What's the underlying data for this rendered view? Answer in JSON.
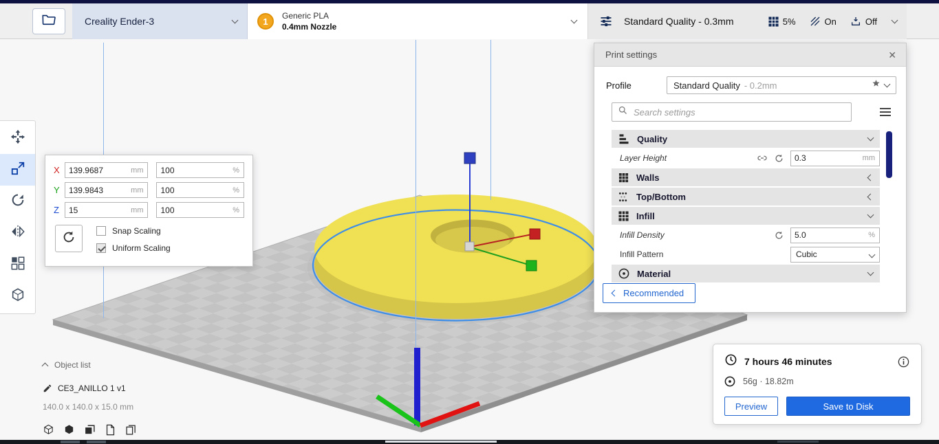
{
  "header": {
    "printer_name": "Creality Ender-3",
    "material_badge": "1",
    "material_name": "Generic PLA",
    "material_nozzle": "0.4mm Nozzle",
    "setup_label": "Standard Quality - 0.3mm",
    "infill_pct": "5%",
    "adhesion_state": "On",
    "support_state": "Off"
  },
  "scale_panel": {
    "rows": [
      {
        "axis": "X",
        "value": "139.9687",
        "unit": "mm",
        "pct": "100",
        "pct_unit": "%"
      },
      {
        "axis": "Y",
        "value": "139.9843",
        "unit": "mm",
        "pct": "100",
        "pct_unit": "%"
      },
      {
        "axis": "Z",
        "value": "15",
        "unit": "mm",
        "pct": "100",
        "pct_unit": "%"
      }
    ],
    "snap_label": "Snap Scaling",
    "uniform_label": "Uniform Scaling"
  },
  "print_settings": {
    "title": "Print settings",
    "close": "✕",
    "profile_label": "Profile",
    "profile_value": "Standard Quality",
    "profile_suffix": "- 0.2mm",
    "search_placeholder": "Search settings",
    "sections": [
      {
        "label": "Quality"
      },
      {
        "label": "Walls"
      },
      {
        "label": "Top/Bottom"
      },
      {
        "label": "Infill"
      },
      {
        "label": "Material"
      }
    ],
    "rows": {
      "layer_height": {
        "label": "Layer Height",
        "value": "0.3",
        "unit": "mm"
      },
      "infill_density": {
        "label": "Infill Density",
        "value": "5.0",
        "unit": "%"
      },
      "infill_pattern": {
        "label": "Infill Pattern",
        "value": "Cubic"
      }
    },
    "recommended_label": "Recommended"
  },
  "object_list": {
    "toggle_label": "Object list",
    "item_name": "CE3_ANILLO 1 v1",
    "dimensions": "140.0 x 140.0 x 15.0 mm"
  },
  "summary": {
    "time": "7 hours 46 minutes",
    "material_usage": "56g · 18.82m",
    "preview_label": "Preview",
    "save_label": "Save to Disk"
  },
  "colors": {
    "accent_blue": "#1f6ae0",
    "model_yellow": "#efe054",
    "axis_x_red": "#e11212",
    "axis_y_green": "#19c319",
    "axis_z_blue": "#2020cf"
  }
}
